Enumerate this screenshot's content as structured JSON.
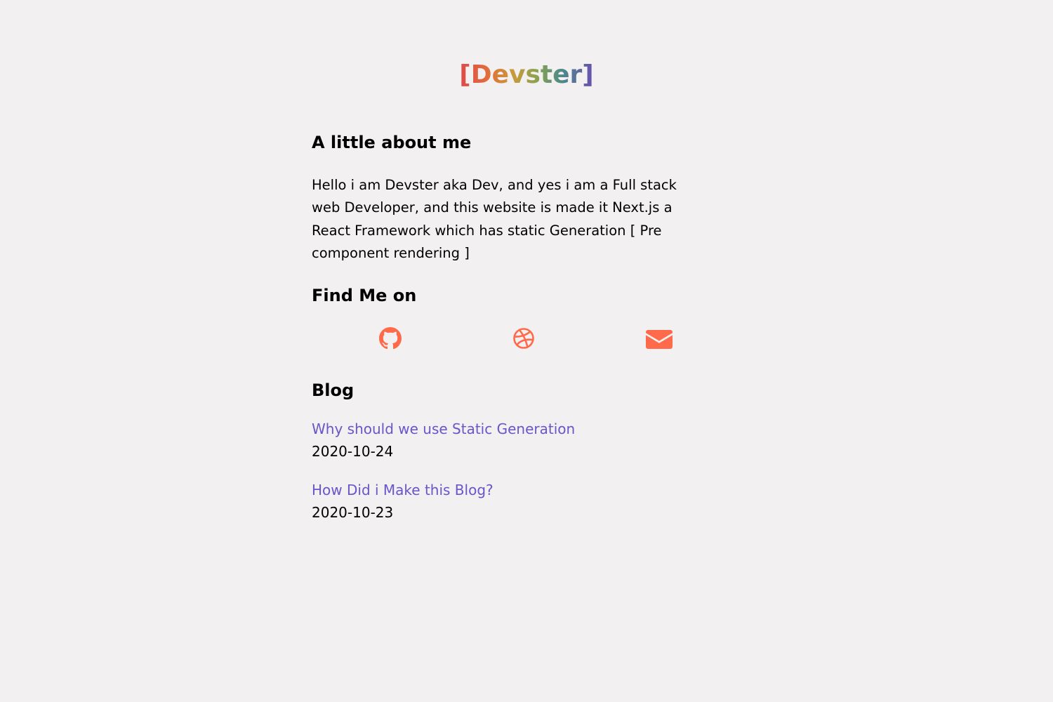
{
  "header": {
    "logo_text": "[Devster]"
  },
  "about": {
    "title": "A little about me",
    "text": "Hello i am Devster aka Dev, and yes i am a Full stack web Developer, and this website is made it Next.js a React Framework which has static Generation [ Pre component rendering ]"
  },
  "find_me": {
    "title": "Find Me on",
    "links": [
      {
        "icon": "github-icon"
      },
      {
        "icon": "dribbble-icon"
      },
      {
        "icon": "mail-icon"
      }
    ],
    "icon_color": "#ff6b4a"
  },
  "blog": {
    "title": "Blog",
    "posts": [
      {
        "title": "Why should we use Static Generation",
        "date": "2020-10-24"
      },
      {
        "title": "How Did i Make this Blog?",
        "date": "2020-10-23"
      }
    ]
  },
  "colors": {
    "background": "#f2f0f1",
    "link": "#6a55c9",
    "accent": "#ff6b4a"
  }
}
